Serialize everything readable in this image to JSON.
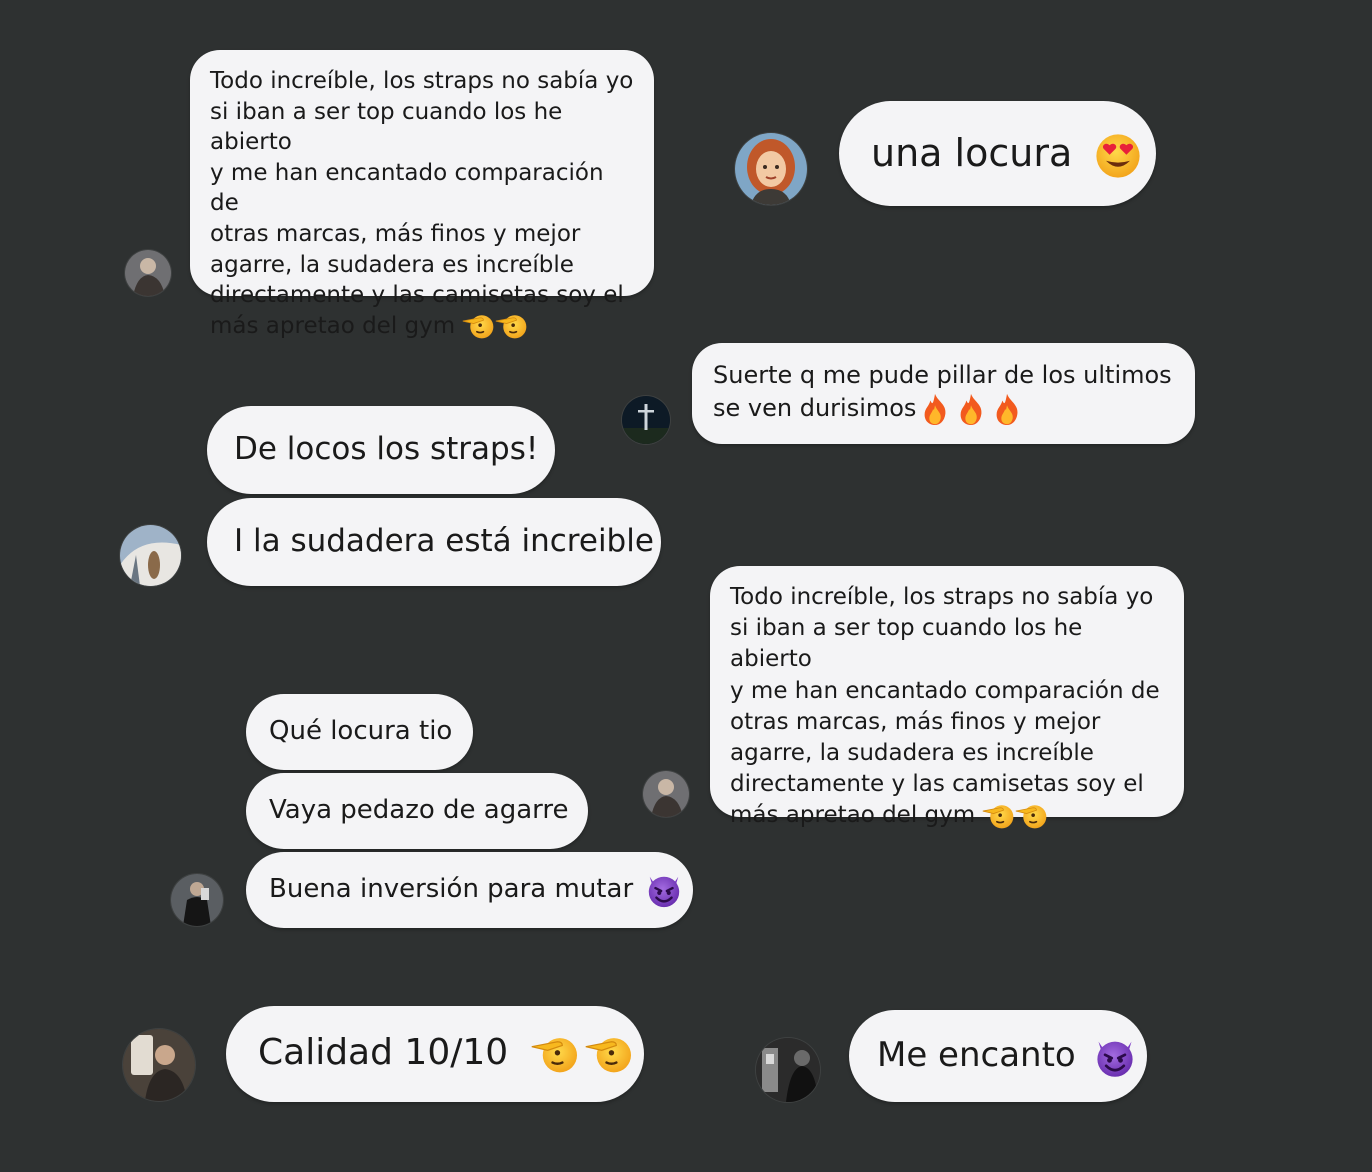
{
  "colors": {
    "background": "#2e3131",
    "bubble": "#f4f4f6",
    "text": "#1a1a1a"
  },
  "messages": {
    "review_top": {
      "lines": [
        "Todo increíble, los straps no sabía yo",
        "si iban a ser top cuando los he abierto",
        "y me han encantado  comparación de",
        "otras marcas, más finos y mejor",
        "agarre, la sudadera es increíble",
        "directamente y las camisetas soy el",
        "más apretao del gym"
      ],
      "emojis": [
        "saluting-face-emoji",
        "saluting-face-emoji"
      ]
    },
    "una_locura": {
      "text": "una locura",
      "emoji": "heart-eyes-emoji"
    },
    "suerte": {
      "lines": [
        "Suerte q me pude pillar de los ultimos",
        "se ven durisimos"
      ],
      "emojis": [
        "fire-emoji",
        "fire-emoji",
        "fire-emoji"
      ]
    },
    "de_locos": {
      "text": "De locos los straps!"
    },
    "sudadera": {
      "text": "I la sudadera está increible"
    },
    "review_right": {
      "lines": [
        "Todo increíble, los straps no sabía yo",
        "si iban a ser top cuando los he abierto",
        "y me han encantado  comparación de",
        "otras marcas, más finos y mejor",
        "agarre, la sudadera es increíble",
        "directamente y las camisetas soy el",
        "más apretao del gym"
      ],
      "emojis": [
        "saluting-face-emoji",
        "saluting-face-emoji"
      ]
    },
    "que_locura": {
      "text": "Qué locura tio"
    },
    "vaya_pedazo": {
      "text": "Vaya pedazo de agarre"
    },
    "buena_inversion": {
      "text": "Buena inversión para mutar",
      "emoji": "smiling-devil-emoji"
    },
    "calidad": {
      "text": "Calidad 10/10",
      "emojis": [
        "saluting-face-emoji",
        "saluting-face-emoji"
      ]
    },
    "me_encanto": {
      "text": "Me encanto",
      "emoji": "smiling-devil-emoji"
    }
  }
}
